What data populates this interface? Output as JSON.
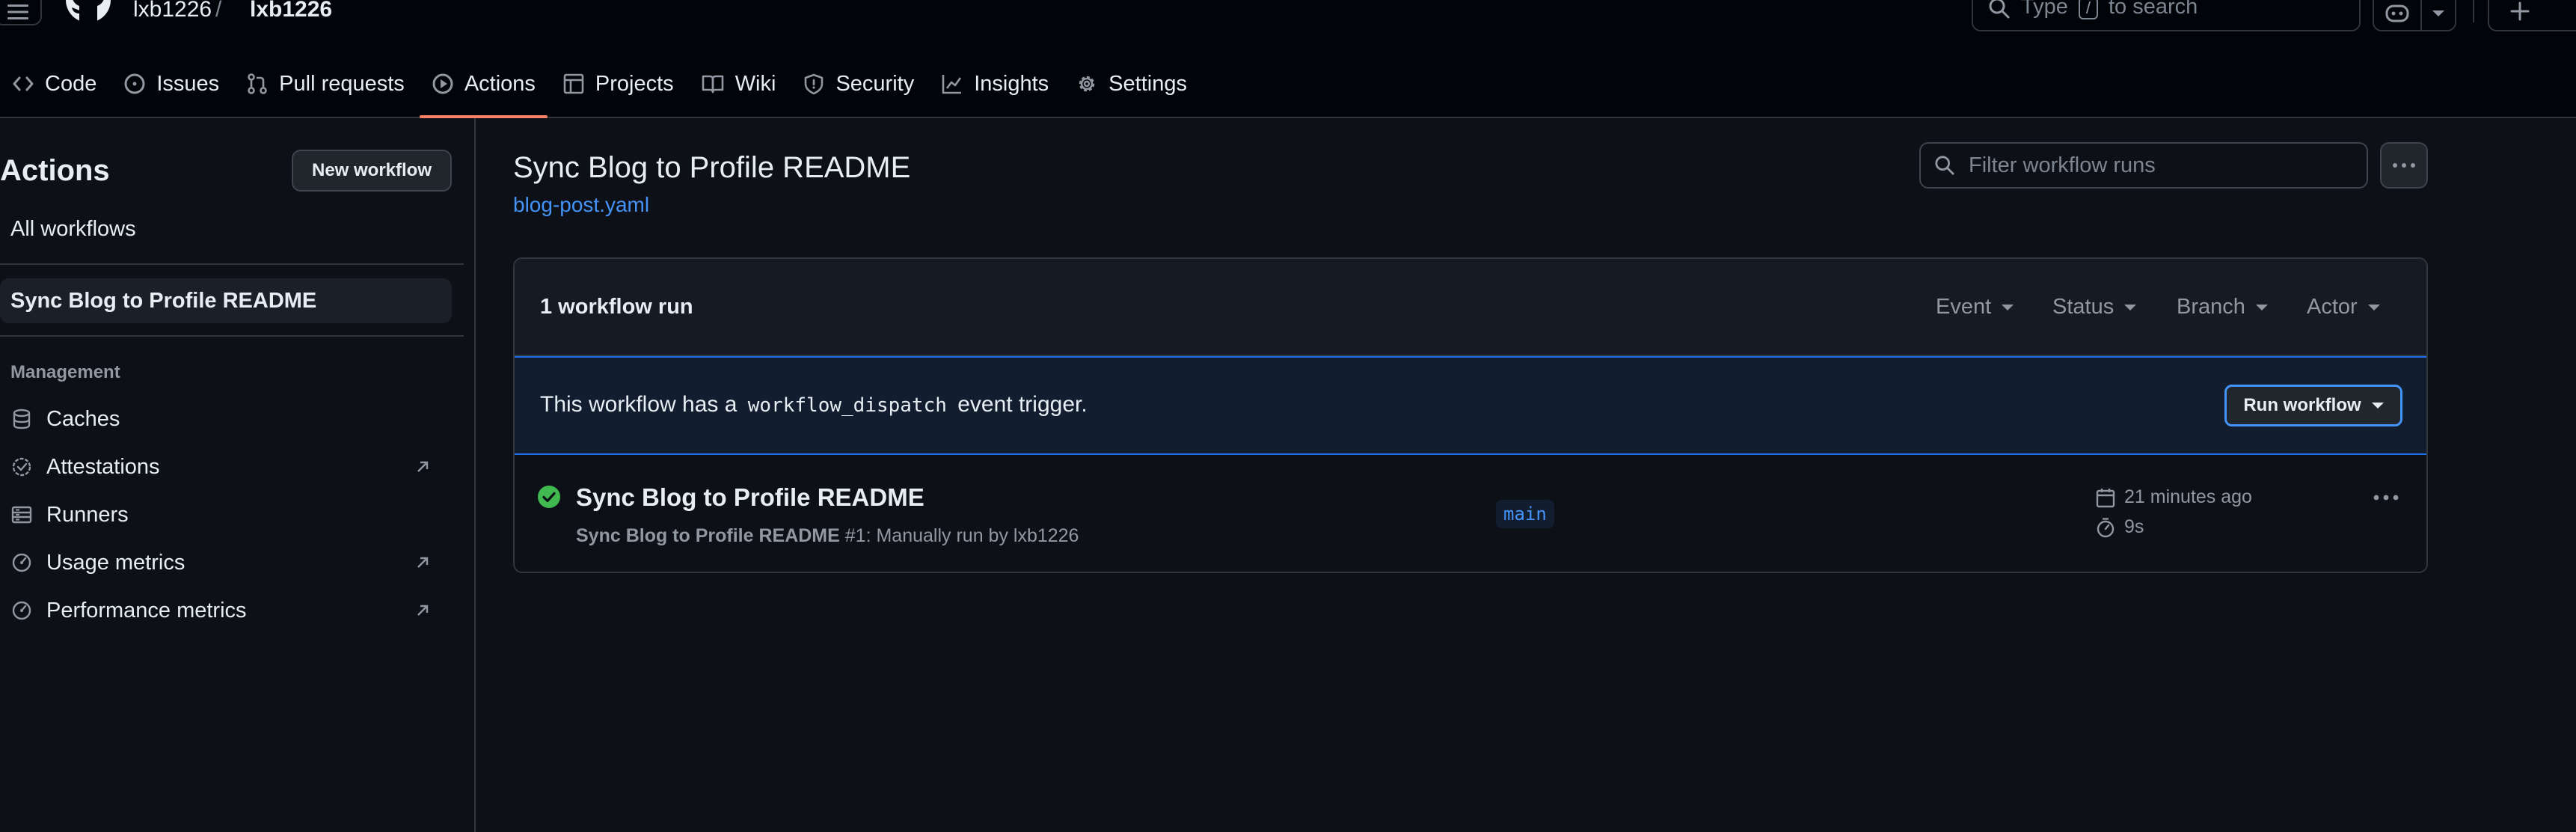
{
  "header": {
    "owner": "lxb1226",
    "separator": "/",
    "repo": "lxb1226",
    "search": {
      "prefix": "Type",
      "key": "/",
      "suffix": "to search"
    }
  },
  "nav": {
    "tabs": [
      {
        "label": "Code",
        "icon": "code-icon",
        "active": false
      },
      {
        "label": "Issues",
        "icon": "issue-opened-icon",
        "active": false
      },
      {
        "label": "Pull requests",
        "icon": "git-pull-request-icon",
        "active": false
      },
      {
        "label": "Actions",
        "icon": "play-icon",
        "active": true
      },
      {
        "label": "Projects",
        "icon": "table-icon",
        "active": false
      },
      {
        "label": "Wiki",
        "icon": "book-icon",
        "active": false
      },
      {
        "label": "Security",
        "icon": "shield-icon",
        "active": false
      },
      {
        "label": "Insights",
        "icon": "graph-icon",
        "active": false
      },
      {
        "label": "Settings",
        "icon": "gear-icon",
        "active": false
      }
    ]
  },
  "sidebar": {
    "title": "Actions",
    "new_workflow": "New workflow",
    "all_workflows": "All workflows",
    "workflows": [
      "Sync Blog to Profile README"
    ],
    "management_heading": "Management",
    "management": [
      {
        "label": "Caches",
        "icon": "database-icon",
        "external": false
      },
      {
        "label": "Attestations",
        "icon": "verified-icon",
        "external": true
      },
      {
        "label": "Runners",
        "icon": "server-icon",
        "external": false
      },
      {
        "label": "Usage metrics",
        "icon": "meter-icon",
        "external": true
      },
      {
        "label": "Performance metrics",
        "icon": "meter-icon",
        "external": true
      }
    ]
  },
  "main": {
    "title": "Sync Blog to Profile README",
    "file": "blog-post.yaml",
    "filter_placeholder": "Filter workflow runs",
    "runs_count": "1 workflow run",
    "filters": [
      "Event",
      "Status",
      "Branch",
      "Actor"
    ],
    "dispatch": {
      "prefix": "This workflow has a",
      "code": "workflow_dispatch",
      "suffix": "event trigger."
    },
    "run_workflow": "Run workflow",
    "run": {
      "title": "Sync Blog to Profile README",
      "meta_name": "Sync Blog to Profile README",
      "meta_rest": "#1: Manually run by lxb1226",
      "branch": "main",
      "time": "21 minutes ago",
      "duration": "9s",
      "status": "success"
    }
  },
  "colors": {
    "accent": "#f78166",
    "link": "#4493f8",
    "success": "#3fb950",
    "background": "#0d1117"
  }
}
